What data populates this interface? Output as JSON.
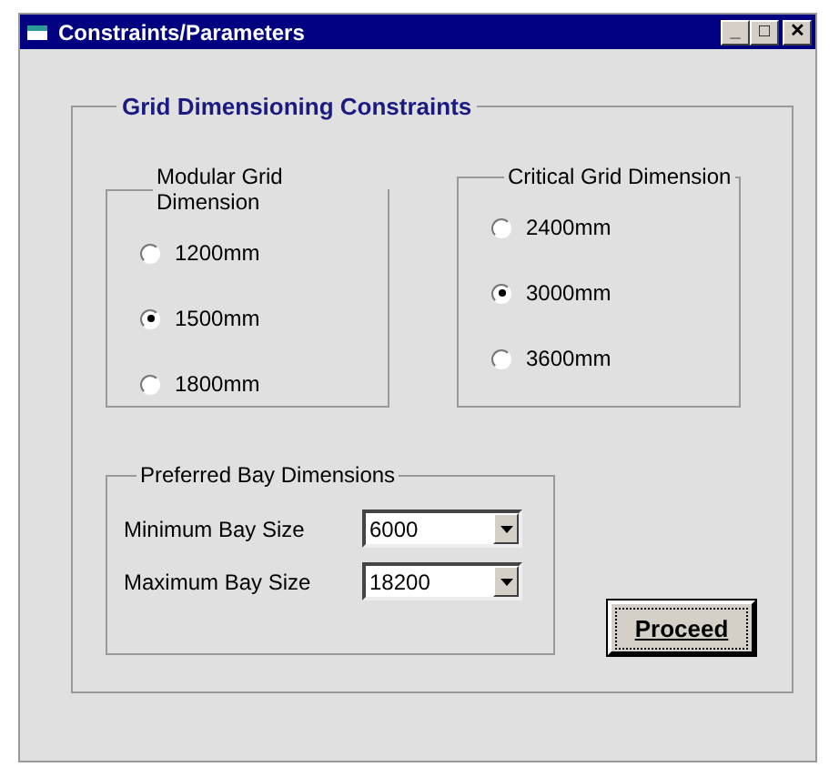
{
  "window": {
    "title": "Constraints/Parameters",
    "controls": [
      "_",
      "□",
      "✕"
    ]
  },
  "main_group": {
    "title": "Grid Dimensioning Constraints",
    "radio_groups": [
      {
        "title": "Modular Grid Dimension",
        "options": [
          {
            "label": "1200mm",
            "selected": false
          },
          {
            "label": "1500mm",
            "selected": true
          },
          {
            "label": "1800mm",
            "selected": false
          }
        ]
      },
      {
        "title": "Critical Grid Dimension",
        "options": [
          {
            "label": "2400mm",
            "selected": false
          },
          {
            "label": "3000mm",
            "selected": true
          },
          {
            "label": "3600mm",
            "selected": false
          }
        ]
      }
    ],
    "bay_group": {
      "title": "Preferred Bay Dimensions",
      "fields": [
        {
          "label": "Minimum Bay Size",
          "value": "6000"
        },
        {
          "label": "Maximum Bay Size",
          "value": "18200"
        }
      ]
    },
    "button": "Proceed"
  }
}
